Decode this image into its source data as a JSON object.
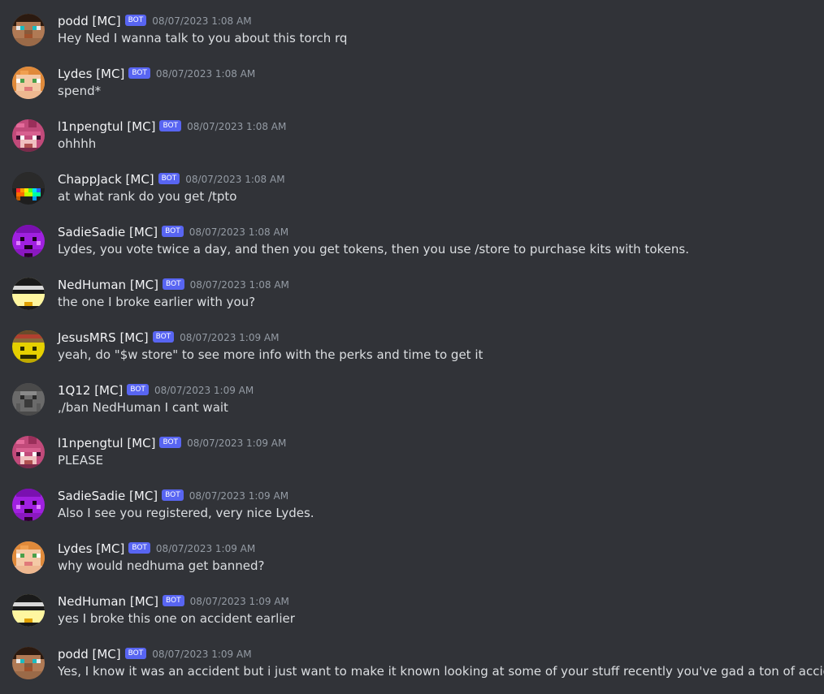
{
  "bot_tag": "BOT",
  "colors": {
    "background": "#313338",
    "username": "#f2f3f5",
    "message": "#dbdee1",
    "timestamp": "#949ba4",
    "bot_tag": "#5865f2"
  },
  "messages": [
    {
      "author": "podd [MC]",
      "timestamp": "08/07/2023 1:08 AM",
      "text": "Hey Ned I wanna talk to you about this torch rq",
      "avatar": "podd-avatar"
    },
    {
      "author": "Lydes [MC]",
      "timestamp": "08/07/2023 1:08 AM",
      "text": "spend*",
      "avatar": "lydes-avatar"
    },
    {
      "author": "l1npengtul [MC]",
      "timestamp": "08/07/2023 1:08 AM",
      "text": "ohhhh",
      "avatar": "l1npengtul-avatar"
    },
    {
      "author": "ChappJack [MC]",
      "timestamp": "08/07/2023 1:08 AM",
      "text": "at what rank do you get /tpto",
      "avatar": "chappjack-avatar"
    },
    {
      "author": "SadieSadie [MC]",
      "timestamp": "08/07/2023 1:08 AM",
      "text": "Lydes, you vote twice a day, and then you get tokens, then you use /store to purchase kits with tokens.",
      "avatar": "sadiesadie-avatar"
    },
    {
      "author": "NedHuman [MC]",
      "timestamp": "08/07/2023 1:08 AM",
      "text": "the one I broke earlier with you?",
      "avatar": "nedhuman-avatar"
    },
    {
      "author": "JesusMRS [MC]",
      "timestamp": "08/07/2023 1:09 AM",
      "text": "yeah, do \"$w store\" to see more info with the perks and time to get it",
      "avatar": "jesusmrs-avatar"
    },
    {
      "author": "1Q12 [MC]",
      "timestamp": "08/07/2023 1:09 AM",
      "text": ",/ban NedHuman I cant wait",
      "avatar": "1q12-avatar"
    },
    {
      "author": "l1npengtul [MC]",
      "timestamp": "08/07/2023 1:09 AM",
      "text": "PLEASE",
      "avatar": "l1npengtul-avatar"
    },
    {
      "author": "SadieSadie [MC]",
      "timestamp": "08/07/2023 1:09 AM",
      "text": "Also I see you registered, very nice Lydes.",
      "avatar": "sadiesadie-avatar"
    },
    {
      "author": "Lydes [MC]",
      "timestamp": "08/07/2023 1:09 AM",
      "text": "why would nedhuma get banned?",
      "avatar": "lydes-avatar"
    },
    {
      "author": "NedHuman [MC]",
      "timestamp": "08/07/2023 1:09 AM",
      "text": "yes I broke this one on accident earlier",
      "avatar": "nedhuman-avatar"
    },
    {
      "author": "podd [MC]",
      "timestamp": "08/07/2023 1:09 AM",
      "text": "Yes, I know it was an accident but i just want to make it known looking at some of your stuff recently you've gad a ton of accidents",
      "avatar": "podd-avatar"
    }
  ]
}
